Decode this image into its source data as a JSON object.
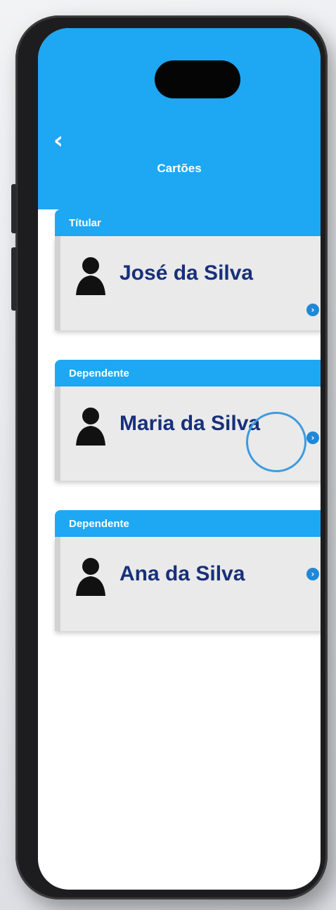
{
  "header": {
    "title": "Cartões",
    "back_icon": "chevron-left-icon"
  },
  "colors": {
    "accent": "#1ea7f2",
    "name_text": "#17307a",
    "card_bg": "#eaeaea",
    "chevron": "#1e88d8"
  },
  "cards": [
    {
      "type_label": "Títular",
      "name": "José da Silva",
      "icon": "person-icon",
      "action_icon": "chevron-right-circle-icon"
    },
    {
      "type_label": "Dependente",
      "name": "Maria da Silva",
      "icon": "person-icon",
      "action_icon": "chevron-right-circle-icon",
      "highlighted": true
    },
    {
      "type_label": "Dependente",
      "name": "Ana da Silva",
      "icon": "person-icon",
      "action_icon": "chevron-right-circle-icon"
    }
  ]
}
